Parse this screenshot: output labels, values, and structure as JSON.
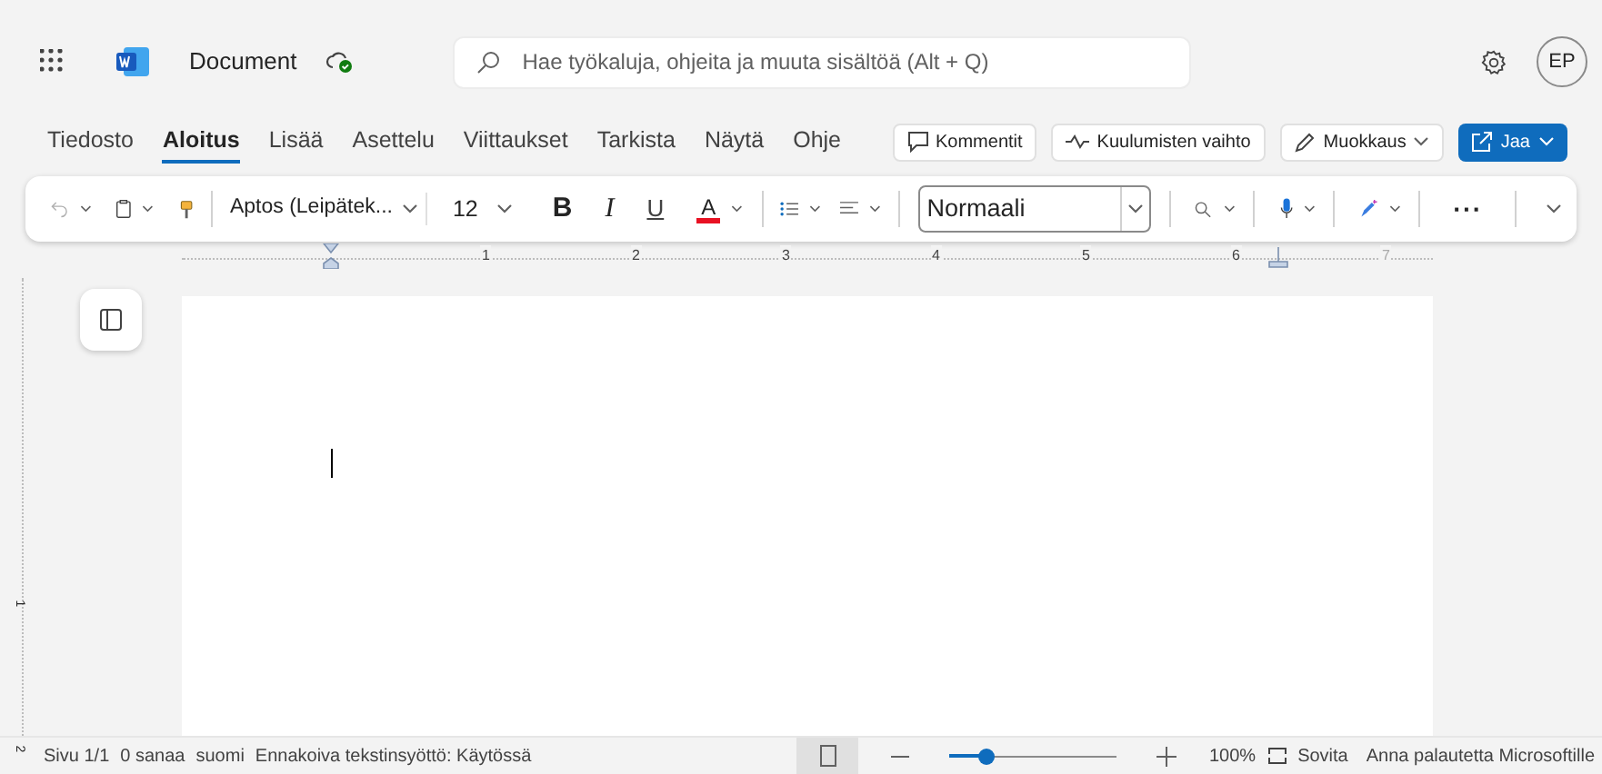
{
  "title_bar": {
    "document_name": "Document",
    "search": {
      "placeholder": "Hae työkaluja, ohjeita ja muuta sisältöä (Alt + Q)"
    },
    "avatar_initials": "EP"
  },
  "tabs": [
    {
      "label": "Tiedosto",
      "selected": false
    },
    {
      "label": "Aloitus",
      "selected": true
    },
    {
      "label": "Lisää",
      "selected": false
    },
    {
      "label": "Asettelu",
      "selected": false
    },
    {
      "label": "Viittaukset",
      "selected": false
    },
    {
      "label": "Tarkista",
      "selected": false
    },
    {
      "label": "Näytä",
      "selected": false
    },
    {
      "label": "Ohje",
      "selected": false
    }
  ],
  "ribbon_buttons": [
    {
      "label": "Kommentit",
      "kind": "comment"
    },
    {
      "label": "Kuulumisten vaihto",
      "kind": "catchup"
    },
    {
      "label": "Muokkaus",
      "kind": "edit"
    },
    {
      "label": "Jaa",
      "kind": "share"
    }
  ],
  "toolbar": {
    "font": "Aptos (Leipätek...",
    "size": "12",
    "bold": "B",
    "italic": "I",
    "underline": "U",
    "font_color": "A",
    "style": "Normaali",
    "more": "···"
  },
  "ruler": {
    "numbers": [
      "1",
      "2",
      "3",
      "4",
      "5",
      "6",
      "7"
    ],
    "vertical_numbers": [
      "1",
      "2"
    ]
  },
  "status_bar": {
    "items": [
      "Sivu 1/1",
      "0 sanaa",
      "suomi",
      "Ennakoiva tekstinsyöttö: Käytössä"
    ],
    "zoom": {
      "level": 0.22,
      "reading": "100%"
    },
    "fit": "Sovita",
    "feedback": "Anna palautetta Microsoftille"
  }
}
